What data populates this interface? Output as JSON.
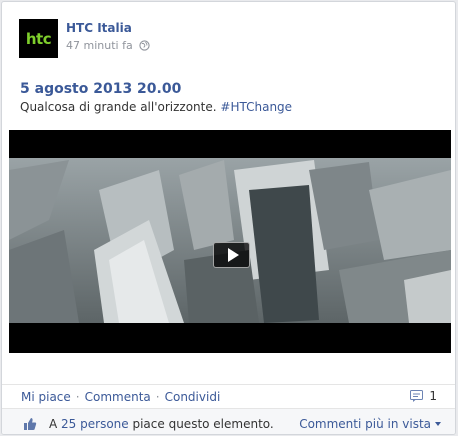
{
  "post": {
    "page_name": "HTC Italia",
    "avatar_text": "htc",
    "timestamp": "47 minuti fa",
    "title": "5 agosto 2013 20.00",
    "text": "Qualcosa di grande all'orizzonte.",
    "hashtag": "#HTChange"
  },
  "actions": {
    "like": "Mi piace",
    "comment": "Commenta",
    "share": "Condividi",
    "separator": "·",
    "comment_count": "1"
  },
  "likes": {
    "prefix": "A",
    "people": "25 persone",
    "suffix": "piace questo elemento.",
    "top_comments": "Commenti più in vista"
  },
  "colors": {
    "brand": "#3b5998",
    "htc_green": "#7fcf2c"
  },
  "icons": {
    "globe": "globe-icon",
    "play": "play-icon",
    "comment": "comment-bubble-icon",
    "like": "thumbs-up-icon",
    "menu": "chevron-down-icon"
  }
}
